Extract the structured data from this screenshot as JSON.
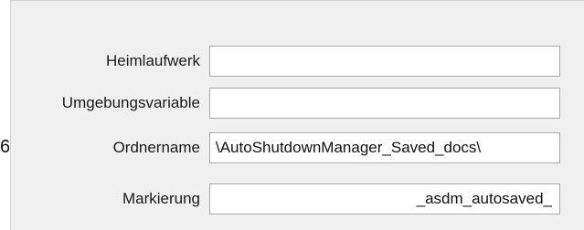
{
  "form": {
    "edge_glyph": "6",
    "fields": [
      {
        "label": "Heimlaufwerk",
        "value": ""
      },
      {
        "label": "Umgebungsvariable",
        "value": ""
      },
      {
        "label": "Ordnername",
        "value": "\\AutoShutdownManager_Saved_docs\\"
      },
      {
        "label": "Markierung",
        "value": "_asdm_autosaved_"
      }
    ]
  }
}
